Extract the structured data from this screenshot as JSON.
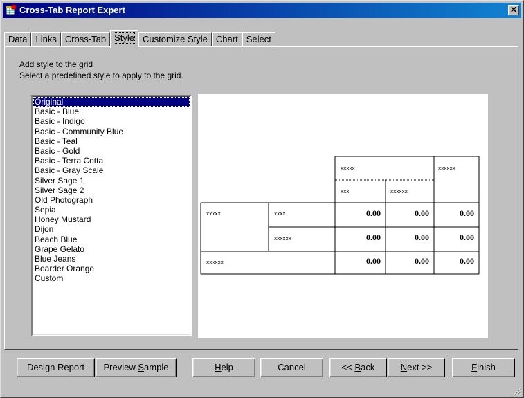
{
  "window": {
    "title": "Cross-Tab Report Expert"
  },
  "tabs": [
    {
      "label": "Data"
    },
    {
      "label": "Links"
    },
    {
      "label": "Cross-Tab"
    },
    {
      "label": "Style"
    },
    {
      "label": "Customize Style"
    },
    {
      "label": "Chart"
    },
    {
      "label": "Select"
    }
  ],
  "active_tab": "Style",
  "panel": {
    "heading": "Add style to the grid",
    "subheading": "Select a predefined style to apply to the grid."
  },
  "styles_list": {
    "selected": "Original",
    "items": [
      "Original",
      "Basic - Blue",
      "Basic - Indigo",
      "Basic - Community Blue",
      "Basic - Teal",
      "Basic - Gold",
      "Basic - Terra Cotta",
      "Basic - Gray Scale",
      "Silver Sage 1",
      "Silver Sage 2",
      "Old Photograph",
      "Sepia",
      "Honey Mustard",
      "Dijon",
      "Beach Blue",
      "Grape Gelato",
      "Blue Jeans",
      "Boarder Orange",
      "Custom"
    ]
  },
  "preview": {
    "col_group": "xxxxx",
    "col_total": "xxxxxx",
    "col_a": "xxx",
    "col_b": "xxxxxx",
    "row_group": "xxxxx",
    "row_a": "xxxx",
    "row_b": "xxxxxx",
    "row_total": "xxxxxx",
    "cells": [
      [
        "0.00",
        "0.00",
        "0.00"
      ],
      [
        "0.00",
        "0.00",
        "0.00"
      ],
      [
        "0.00",
        "0.00",
        "0.00"
      ]
    ]
  },
  "buttons": {
    "design_report": "Design Report",
    "preview_sample_prefix": "Preview ",
    "preview_sample_ul": "S",
    "preview_sample_suffix": "ample",
    "help_ul": "H",
    "help_rest": "elp",
    "cancel": "Cancel",
    "back_prefix": "<< ",
    "back_ul": "B",
    "back_rest": "ack",
    "next_ul": "N",
    "next_rest": "ext >>",
    "finish_ul": "F",
    "finish_rest": "inish"
  }
}
